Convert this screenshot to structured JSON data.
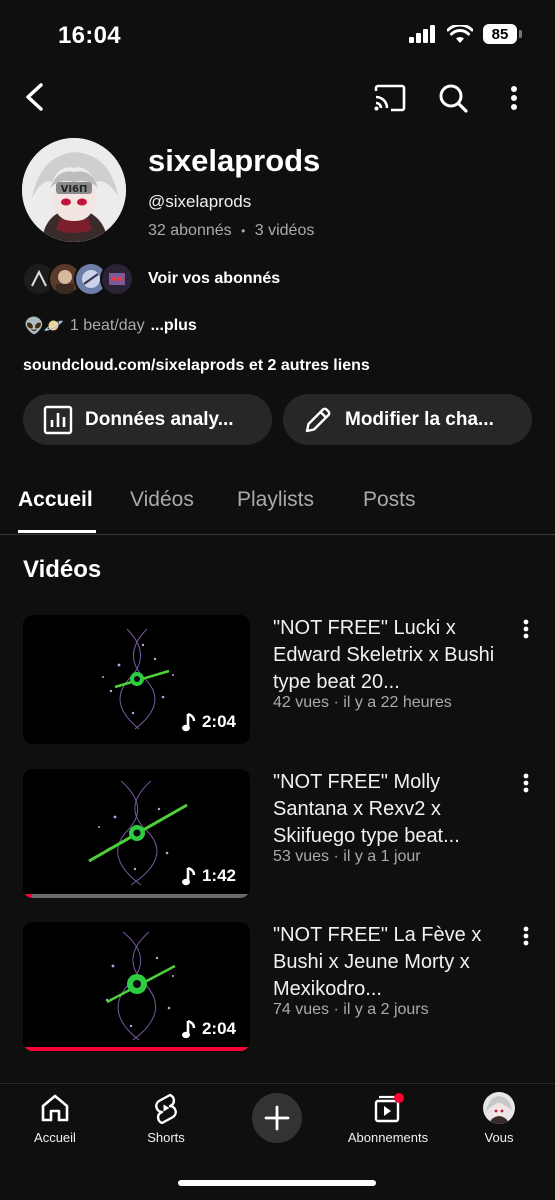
{
  "status_bar": {
    "time": "16:04",
    "battery": "85"
  },
  "channel": {
    "name": "sixelaprods",
    "handle": "@sixelaprods",
    "subscribers": "32 abonnés",
    "separator": "•",
    "videos_count": "3 vidéos",
    "subscribers_link": "Voir vos abonnés",
    "description_emoji": "👽🪐",
    "description": "1 beat/day",
    "more": "...plus",
    "links": "soundcloud.com/sixelaprods et 2 autres liens",
    "avatar_text": "VI6П"
  },
  "actions": {
    "analytics": "Données analy...",
    "edit": "Modifier la cha..."
  },
  "tabs": [
    "Accueil",
    "Vidéos",
    "Playlists",
    "Posts"
  ],
  "section_title": "Vidéos",
  "videos": [
    {
      "title": "\"NOT FREE\" Lucki x Edward Skeletrix x Bushi type beat 20...",
      "meta": "42 vues · il y a 22 heures",
      "duration": "2:04",
      "watched": 0
    },
    {
      "title": "\"NOT FREE\" Molly Santana x Rexv2 x Skiifuego type beat...",
      "meta": "53 vues · il y a 1 jour",
      "duration": "1:42",
      "watched": 0.04
    },
    {
      "title": "\"NOT FREE\" La Fève x Bushi x Jeune Morty x Mexikodro...",
      "meta": "74 vues · il y a 2 jours",
      "duration": "2:04",
      "watched": 1.0
    }
  ],
  "nav": {
    "home": "Accueil",
    "shorts": "Shorts",
    "subscriptions": "Abonnements",
    "you": "Vous"
  },
  "colors": {
    "background": "#0f0f0f",
    "accent": "#ff0033",
    "pill": "#272727"
  }
}
